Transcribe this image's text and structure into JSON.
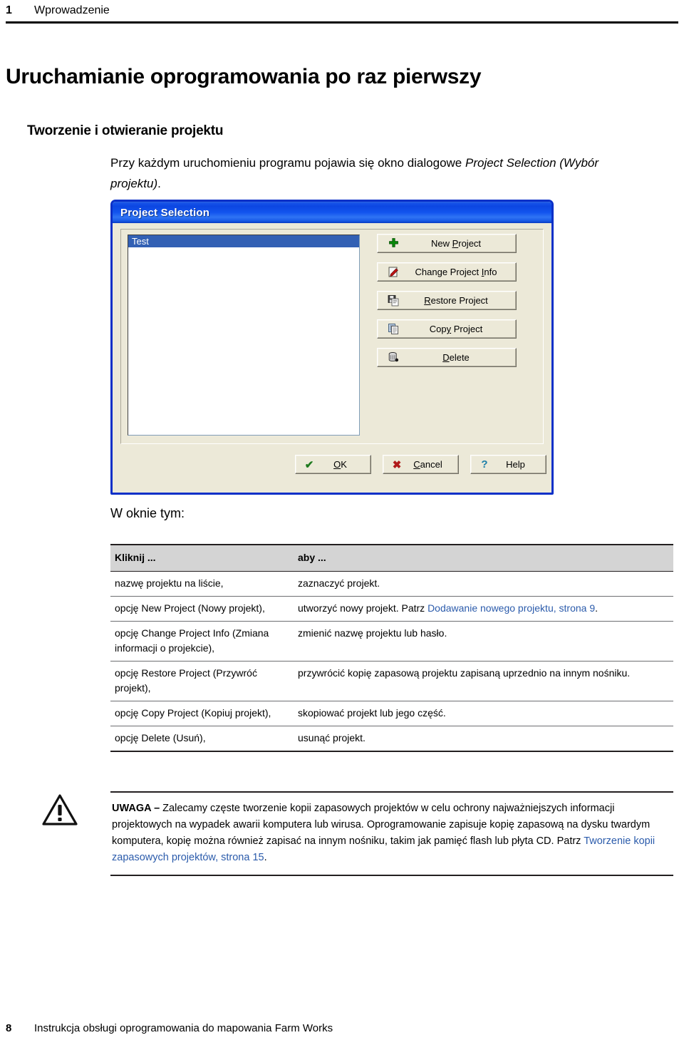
{
  "header": {
    "chapter_number": "1",
    "chapter_name": "Wprowadzenie"
  },
  "chapter_title": "Uruchamianie oprogramowania po raz pierwszy",
  "section_heading": "Tworzenie i otwieranie projektu",
  "intro_paragraph": {
    "part1": "Przy każdym uruchomieniu programu pojawia się okno dialogowe ",
    "emphasis": "Project Selection (Wybór projektu)",
    "part2": "."
  },
  "dialog": {
    "title": "Project Selection",
    "list": {
      "items": [
        {
          "label": "Test",
          "selected": true
        }
      ]
    },
    "action_buttons": [
      {
        "label_pre": "New ",
        "label_key": "P",
        "label_post": "roject",
        "icon": "plus-icon"
      },
      {
        "label_pre": "Change Project ",
        "label_key": "I",
        "label_post": "nfo",
        "icon": "edit-project-icon"
      },
      {
        "label_pre": "",
        "label_key": "R",
        "label_post": "estore Project",
        "icon": "restore-disk-icon"
      },
      {
        "label_pre": "Cop",
        "label_key": "y",
        "label_post": " Project",
        "icon": "copy-pages-icon"
      },
      {
        "label_pre": "",
        "label_key": "D",
        "label_post": "elete",
        "icon": "trash-can-icon"
      }
    ],
    "footer_buttons": [
      {
        "label_pre": "",
        "label_key": "O",
        "label_post": "K",
        "icon": "check-icon",
        "icon_glyph": "✔",
        "icon_color": "#1e7a1e"
      },
      {
        "label_pre": "",
        "label_key": "C",
        "label_post": "ancel",
        "icon": "cross-icon",
        "icon_glyph": "✖",
        "icon_color": "#b01a1a"
      },
      {
        "label_pre": "Help",
        "label_key": "",
        "label_post": "",
        "icon": "question-mark-icon",
        "icon_glyph": "?",
        "icon_color": "#1c7fa8"
      }
    ]
  },
  "lead_in": "W oknie tym:",
  "table": {
    "headers": [
      "Kliknij ...",
      "aby ..."
    ],
    "rows": [
      {
        "action": "nazwę projektu na liście,",
        "result_pre": "zaznaczyć projekt.",
        "result_link": "",
        "result_post": ""
      },
      {
        "action": "opcję New Project (Nowy projekt),",
        "result_pre": "utworzyć nowy projekt. Patrz ",
        "result_link": "Dodawanie nowego projektu, strona 9",
        "result_post": "."
      },
      {
        "action": "opcję Change Project Info (Zmiana informacji o projekcie),",
        "result_pre": "zmienić nazwę projektu lub hasło.",
        "result_link": "",
        "result_post": ""
      },
      {
        "action": "opcję Restore Project (Przywróć projekt),",
        "result_pre": "przywrócić kopię zapasową projektu zapisaną uprzednio na innym nośniku.",
        "result_link": "",
        "result_post": ""
      },
      {
        "action": "opcję Copy Project (Kopiuj projekt),",
        "result_pre": "skopiować projekt lub jego część.",
        "result_link": "",
        "result_post": ""
      },
      {
        "action": "opcję Delete (Usuń),",
        "result_pre": "usunąć projekt.",
        "result_link": "",
        "result_post": ""
      }
    ]
  },
  "note": {
    "icon": "warning-triangle-icon",
    "label": "UWAGA – ",
    "text_pre": "Zalecamy częste tworzenie kopii zapasowych projektów w celu ochrony najważniejszych informacji projektowych na wypadek awarii komputera lub wirusa. Oprogramowanie zapisuje kopię zapasową na dysku twardym komputera, kopię można również zapisać na innym nośniku, takim jak pamięć flash lub płyta CD. Patrz ",
    "link": "Tworzenie kopii zapasowych projektów, strona 15",
    "text_post": "."
  },
  "footer": {
    "page_number": "8",
    "text": "Instrukcja obsługi oprogramowania do mapowania Farm Works"
  },
  "colors": {
    "link": "#2b5bab",
    "table_header_bg": "#d4d4d4",
    "dialog_face": "#ece9d8",
    "dialog_titlebar": "#0c46e2",
    "selection": "#3260b4"
  }
}
